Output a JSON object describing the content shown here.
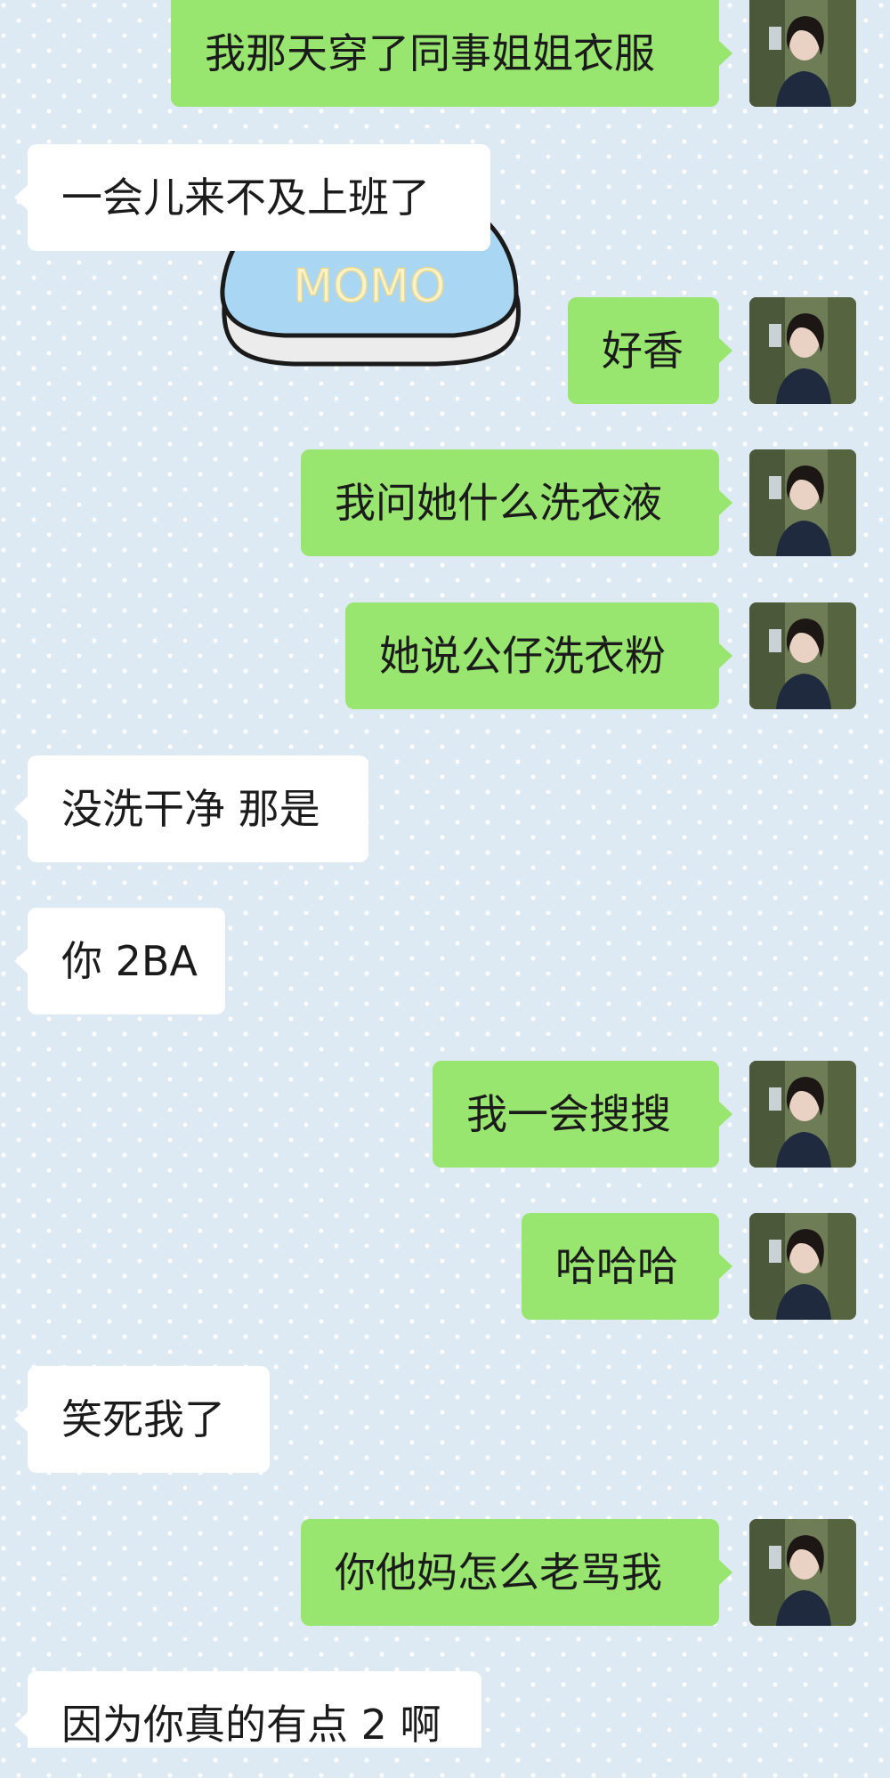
{
  "chat": {
    "messages": [
      {
        "side": "out",
        "text": "我那天穿了同事姐姐衣服"
      },
      {
        "side": "in",
        "text": "一会儿来不及上班了"
      },
      {
        "side": "out",
        "text": "好香"
      },
      {
        "side": "out",
        "text": "我问她什么洗衣液"
      },
      {
        "side": "out",
        "text": "她说公仔洗衣粉"
      },
      {
        "side": "in",
        "text": "没洗干净 那是"
      },
      {
        "side": "in",
        "text": "你 2BA"
      },
      {
        "side": "out",
        "text": "我一会搜搜"
      },
      {
        "side": "out",
        "text": "哈哈哈"
      },
      {
        "side": "in",
        "text": "笑死我了"
      },
      {
        "side": "out",
        "text": "你他妈怎么老骂我"
      },
      {
        "side": "in",
        "text": "因为你真的有点 2 啊"
      }
    ],
    "sticker": {
      "text": "MOMO",
      "icon": "momo-sticker-icon"
    },
    "avatar": {
      "icon": "user-avatar-photo"
    }
  },
  "colors": {
    "background": "#dde9f3",
    "outgoing_bubble": "#98e56f",
    "incoming_bubble": "#ffffff"
  }
}
